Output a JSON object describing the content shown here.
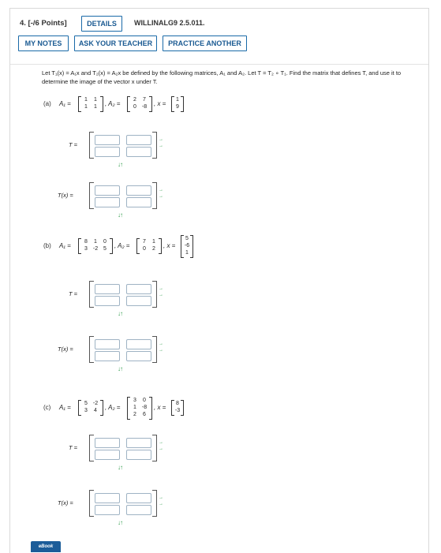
{
  "question": {
    "number": "4. [-/6 Points]",
    "details_label": "DETAILS",
    "code": "WILLINALG9 2.5.011.",
    "my_notes_label": "MY NOTES",
    "ask_teacher_label": "ASK YOUR TEACHER",
    "practice_label": "PRACTICE ANOTHER"
  },
  "intro": "Let T₁(x) = A₁x and T₂(x) = A₂x be defined by the following matrices, A₁ and A₂. Let T = T₂ ∘ T₁. Find the matrix that defines T, and use it to determine the image of the vector x under T.",
  "parts": [
    {
      "label": "(a)",
      "a1_name": "A₁ =",
      "a1": [
        [
          "1",
          "1"
        ],
        [
          "1",
          "1"
        ]
      ],
      "a2_name": "A₂ =",
      "a2": [
        [
          "2",
          "7"
        ],
        [
          "0",
          "-8"
        ]
      ],
      "x_name": "x =",
      "x": [
        "1",
        "9"
      ],
      "t_label": "T =",
      "tx_label": "T(x) ="
    },
    {
      "label": "(b)",
      "a1_name": "A₁ =",
      "a1": [
        [
          "8",
          "1",
          "0"
        ],
        [
          "3",
          "-2",
          "5"
        ]
      ],
      "a2_name": "A₂ =",
      "a2": [
        [
          "7",
          "1"
        ],
        [
          "0",
          "2"
        ]
      ],
      "x_name": "x =",
      "x": [
        "5",
        "-6",
        "1"
      ],
      "t_label": "T =",
      "tx_label": "T(x) ="
    },
    {
      "label": "(c)",
      "a1_name": "A₁ =",
      "a1": [
        [
          "5",
          "-2"
        ],
        [
          "3",
          "4"
        ]
      ],
      "a2_name": "A₂ =",
      "a2": [
        [
          "3",
          "0"
        ],
        [
          "1",
          "-8"
        ],
        [
          "2",
          "6"
        ]
      ],
      "x_name": "x =",
      "x": [
        "8",
        "-3"
      ],
      "t_label": "T =",
      "tx_label": "T(x) ="
    }
  ],
  "ebook_label": "eBook",
  "icons": {
    "arrow_color": "#2e9c4a",
    "up_down": "↓↑",
    "side_arrows": "→→"
  },
  "colors": {
    "accent": "#1a6aa8",
    "ebook": "#1b5c99"
  }
}
